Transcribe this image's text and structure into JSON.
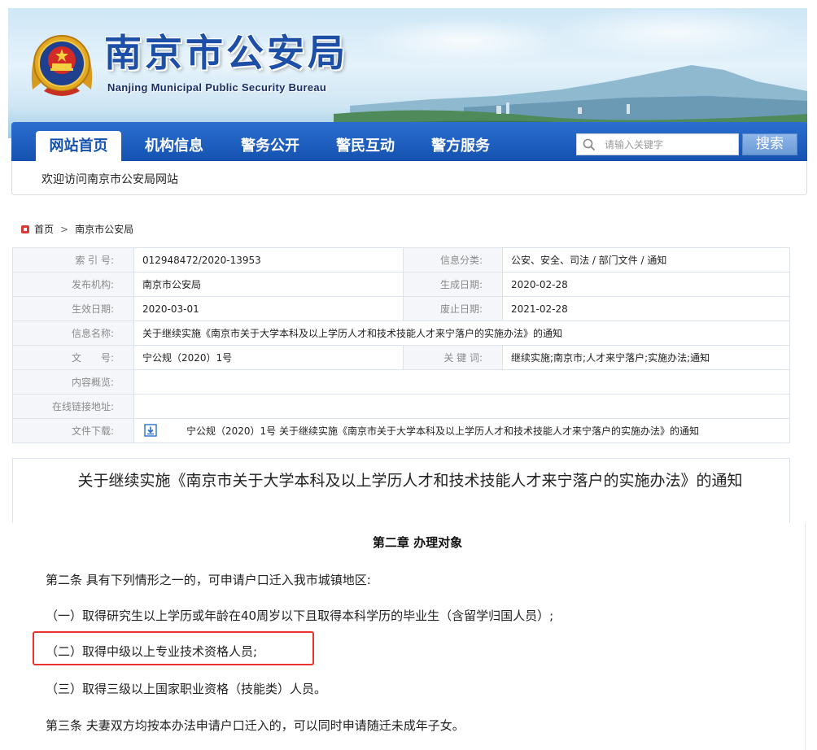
{
  "header": {
    "title": "南京市公安局",
    "subtitle": "Nanjing Municipal Public Security Bureau"
  },
  "nav": {
    "items": [
      {
        "label": "网站首页",
        "active": true
      },
      {
        "label": "机构信息",
        "active": false
      },
      {
        "label": "警务公开",
        "active": false
      },
      {
        "label": "警民互动",
        "active": false
      },
      {
        "label": "警方服务",
        "active": false
      }
    ],
    "search": {
      "placeholder": "请输入关键字",
      "button_label": "搜索"
    }
  },
  "welcome": "欢迎访问南京市公安局网站",
  "breadcrumb": {
    "home": "首页",
    "separator": ">",
    "current": "南京市公安局"
  },
  "info": {
    "index_label": "索 引 号:",
    "index_value": "012948472/2020-13953",
    "category_label": "信息分类:",
    "category_value": "公安、安全、司法 / 部门文件 / 通知",
    "publisher_label": "发布机构:",
    "publisher_value": "南京市公安局",
    "created_label": "生成日期:",
    "created_value": "2020-02-28",
    "effective_label": "生效日期:",
    "effective_value": "2020-03-01",
    "expire_label": "废止日期:",
    "expire_value": "2021-02-28",
    "name_label": "信息名称:",
    "name_value": "关于继续实施《南京市关于大学本科及以上学历人才和技术技能人才来宁落户的实施办法》的通知",
    "docno_label": "文　　号:",
    "docno_value": "宁公规（2020）1号",
    "keywords_label": "关 键 词:",
    "keywords_value": "继续实施;南京市;人才来宁落户;实施办法;通知",
    "summary_label": "内容概览:",
    "summary_value": "",
    "link_label": "在线链接地址:",
    "link_value": "",
    "download_label": "文件下载:",
    "download_value": "宁公规（2020）1号 关于继续实施《南京市关于大学本科及以上学历人才和技术技能人才来宁落户的实施办法》的通知"
  },
  "article": {
    "title": "关于继续实施《南京市关于大学本科及以上学历人才和技术技能人才来宁落户的实施办法》的通知",
    "chapter": "第二章 办理对象",
    "paragraphs": [
      "第二条  具有下列情形之一的，可申请户口迁入我市城镇地区:",
      "（一）取得研究生以上学历或年龄在40周岁以下且取得本科学历的毕业生（含留学归国人员）;",
      "（二）取得中级以上专业技术资格人员;",
      "（三）取得三级以上国家职业资格（技能类）人员。",
      "第三条  夫妻双方均按本办法申请户口迁入的，可以同时申请随迁未成年子女。"
    ]
  },
  "colors": {
    "nav_blue": "#1552b0",
    "title_blue": "#1d4fa6",
    "highlight_red": "#e8332f"
  }
}
